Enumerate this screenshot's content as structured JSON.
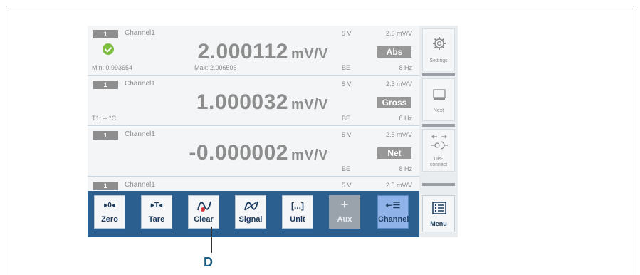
{
  "channels": [
    {
      "number": "1",
      "name": "Channel1",
      "value": "2.000112",
      "unit": "mV/V",
      "left_info": "Min: 0.993654",
      "mid_info": "Max: 2.006506",
      "excitation": "5 V",
      "range": "2.5 mV/V",
      "mode": "Abs",
      "connector": "BE",
      "rate": "8 Hz",
      "status_icon": "check-circle-icon"
    },
    {
      "number": "1",
      "name": "Channel1",
      "value": "1.000032",
      "unit": "mV/V",
      "left_info": "T1: -- °C",
      "mid_info": "",
      "excitation": "5 V",
      "range": "2.5 mV/V",
      "mode": "Gross",
      "connector": "BE",
      "rate": "8 Hz"
    },
    {
      "number": "1",
      "name": "Channel1",
      "value": "-0.000002",
      "unit": "mV/V",
      "left_info": "",
      "mid_info": "",
      "excitation": "5 V",
      "range": "2.5 mV/V",
      "mode": "Net",
      "connector": "BE",
      "rate": "8 Hz"
    },
    {
      "number": "1",
      "name": "Channel1",
      "excitation": "5 V",
      "range": "2.5 mV/V"
    }
  ],
  "side_buttons": {
    "settings": "Settings",
    "next": "Next",
    "disconnect": "Dis-\nconnect"
  },
  "toolbar": {
    "buttons": [
      {
        "icon": "▸0◂",
        "label": "Zero"
      },
      {
        "icon": "▸T◂",
        "label": "Tare"
      },
      {
        "icon": "∿",
        "label": "Clear"
      },
      {
        "icon": "∿",
        "label": "Signal"
      },
      {
        "icon": "[...]",
        "label": "Unit"
      },
      {
        "icon": "+",
        "label": "Aux"
      },
      {
        "icon": "⇠☰",
        "label": "Channel"
      }
    ],
    "menu_label": "Menu"
  },
  "callout": "D",
  "colors": {
    "toolbar": "#2b5f8f",
    "active": "#8fb3e8",
    "ok": "#7fbf3f"
  }
}
